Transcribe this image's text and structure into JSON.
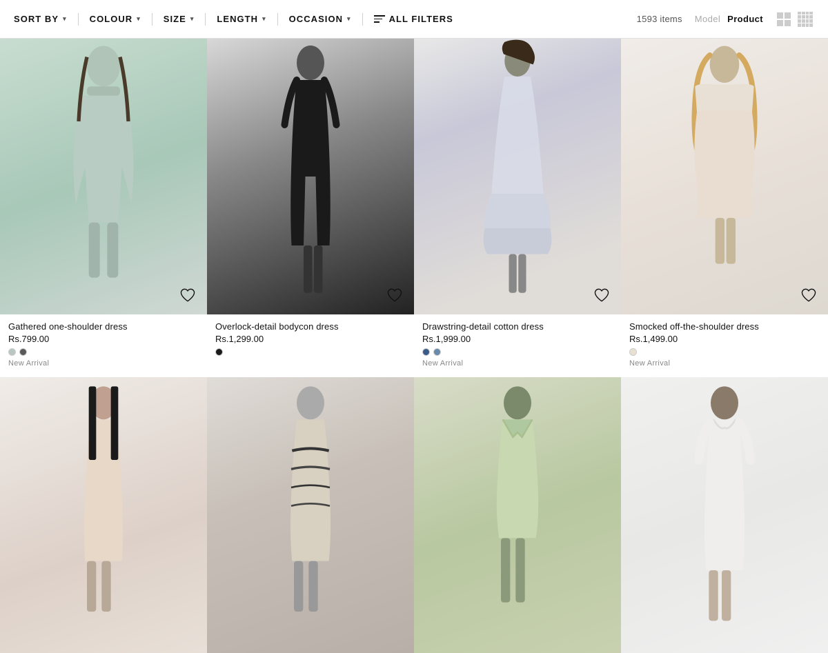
{
  "toolbar": {
    "sort_label": "SORT BY",
    "colour_label": "COLOUR",
    "size_label": "SIZE",
    "length_label": "LENGTH",
    "occasion_label": "OCCASION",
    "all_filters_label": "ALL FILTERS",
    "item_count": "1593 items",
    "view_model_label": "Model",
    "view_product_label": "Product"
  },
  "products": [
    {
      "id": 1,
      "name": "Gathered one-shoulder dress",
      "price": "Rs.799.00",
      "new_arrival": true,
      "new_arrival_label": "New Arrival",
      "swatches": [
        "#b8c8c0",
        "#5a5a5a"
      ],
      "card_class": "card-1"
    },
    {
      "id": 2,
      "name": "Overlock-detail bodycon dress",
      "price": "Rs.1,299.00",
      "new_arrival": false,
      "new_arrival_label": "",
      "swatches": [
        "#1a1a1a"
      ],
      "card_class": "card-2"
    },
    {
      "id": 3,
      "name": "Drawstring-detail cotton dress",
      "price": "Rs.1,999.00",
      "new_arrival": true,
      "new_arrival_label": "New Arrival",
      "swatches": [
        "#3a5a8a",
        "#6a8aaa"
      ],
      "card_class": "card-3"
    },
    {
      "id": 4,
      "name": "Smocked off-the-shoulder dress",
      "price": "Rs.1,499.00",
      "new_arrival": true,
      "new_arrival_label": "New Arrival",
      "swatches": [
        "#e8e0d0"
      ],
      "card_class": "card-4"
    },
    {
      "id": 5,
      "name": "",
      "price": "",
      "new_arrival": false,
      "new_arrival_label": "",
      "swatches": [],
      "card_class": "card-5"
    },
    {
      "id": 6,
      "name": "",
      "price": "",
      "new_arrival": false,
      "new_arrival_label": "",
      "swatches": [],
      "card_class": "card-6"
    },
    {
      "id": 7,
      "name": "",
      "price": "",
      "new_arrival": false,
      "new_arrival_label": "",
      "swatches": [],
      "card_class": "card-7"
    },
    {
      "id": 8,
      "name": "",
      "price": "",
      "new_arrival": false,
      "new_arrival_label": "",
      "swatches": [],
      "card_class": "card-8"
    }
  ]
}
